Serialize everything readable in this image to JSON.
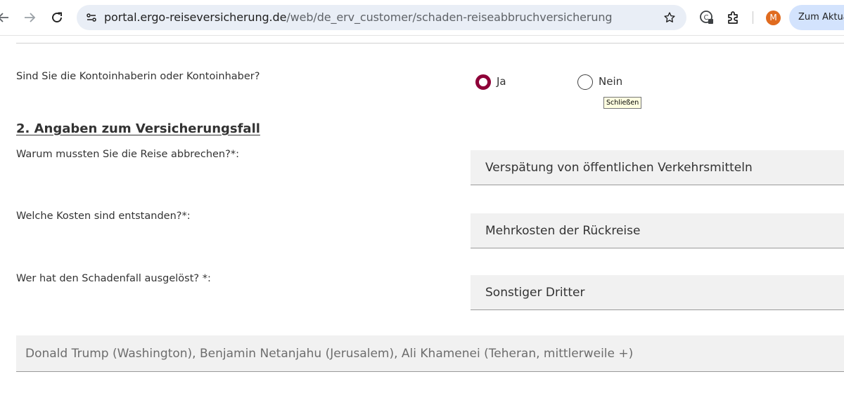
{
  "browser": {
    "url_domain": "portal.ergo-reiseversicherung.de",
    "url_path": "/web/de_erv_customer/schaden-reiseabbruchversicherung",
    "profile_initial": "M",
    "update_button_label": "Zum Aktual",
    "icons": [
      "back-arrow-icon",
      "forward-arrow-icon",
      "reload-icon",
      "site-info-icon",
      "star-icon",
      "extension-shield-icon",
      "puzzle-icon"
    ]
  },
  "form": {
    "account_holder_question": "Sind Sie die Kontoinhaberin oder Kontoinhaber?",
    "radio_yes": "Ja",
    "radio_no": "Nein",
    "radio_selected": "Ja",
    "tooltip": "Schließen",
    "section_title": "2. Angaben zum Versicherungsfall",
    "reason_label": "Warum mussten Sie die Reise abbrechen?*:",
    "reason_value": "Verspätung von öffentlichen Verkehrsmitteln",
    "costs_label": "Welche Kosten sind entstanden?*:",
    "costs_value": "Mehrkosten der Rückreise",
    "trigger_label": "Wer hat den Schadenfall ausgelöst? *:",
    "trigger_value": "Sonstiger Dritter",
    "third_party_value": "Donald Trump (Washington), Benjamin Netanjahu (Jerusalem), Ali Khamenei (Teheran, mittlerweile +)"
  },
  "colors": {
    "accent": "#8e0038",
    "field_bg": "#f1f1f1",
    "omnibox_bg": "#e9eef6",
    "avatar": "#e06b1f"
  }
}
